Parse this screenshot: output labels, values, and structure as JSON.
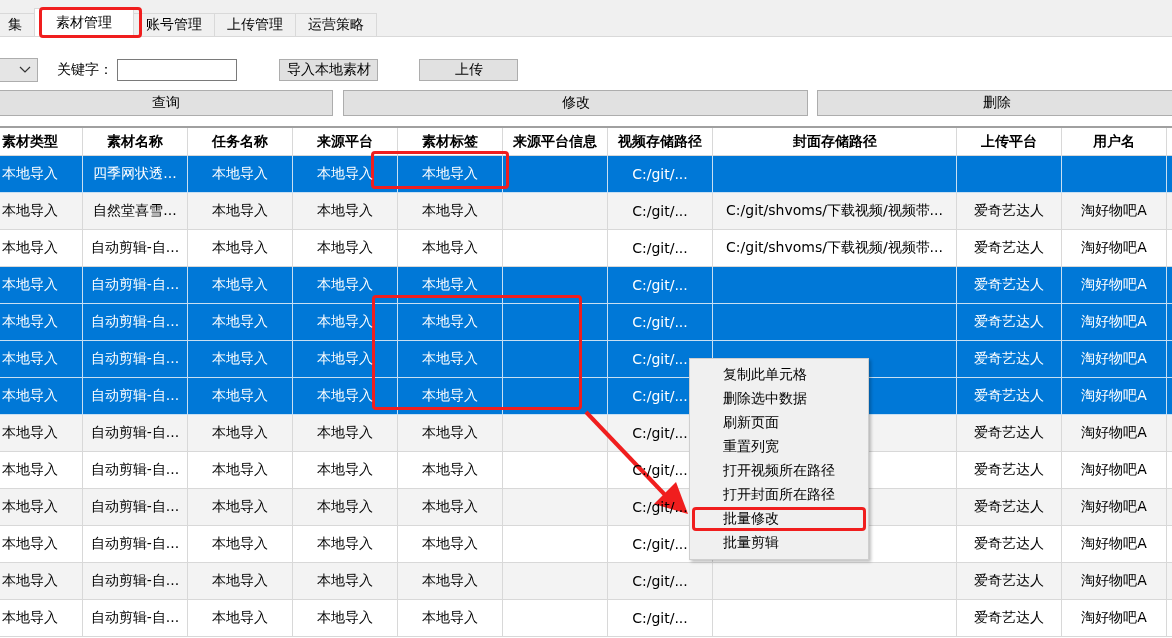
{
  "tabs": [
    {
      "label": "集",
      "selected": false
    },
    {
      "label": "素材管理",
      "selected": true
    },
    {
      "label": "账号管理",
      "selected": false
    },
    {
      "label": "上传管理",
      "selected": false
    },
    {
      "label": "运营策略",
      "selected": false
    }
  ],
  "toolbar": {
    "keyword_label": "关键字：",
    "import_button": "导入本地素材",
    "upload_button": "上传",
    "query_button": "查询",
    "edit_button": "修改",
    "delete_button": "删除"
  },
  "table": {
    "columns": [
      "素材类型",
      "素材名称",
      "任务名称",
      "来源平台",
      "素材标签",
      "来源平台信息",
      "视频存储路径",
      "封面存储路径",
      "上传平台",
      "用户名"
    ],
    "rows": [
      {
        "selected": true,
        "cells": [
          "本地导入",
          "四季网状透...",
          "本地导入",
          "本地导入",
          "本地导入",
          "",
          "C:/git/...",
          "",
          "",
          ""
        ]
      },
      {
        "selected": false,
        "cells": [
          "本地导入",
          "自然堂喜雪...",
          "本地导入",
          "本地导入",
          "本地导入",
          "",
          "C:/git/...",
          "C:/git/shvoms/下载视频/视频带...",
          "爱奇艺达人",
          "淘好物吧A"
        ]
      },
      {
        "selected": false,
        "cells": [
          "本地导入",
          "自动剪辑-自...",
          "本地导入",
          "本地导入",
          "本地导入",
          "",
          "C:/git/...",
          "C:/git/shvoms/下载视频/视频带...",
          "爱奇艺达人",
          "淘好物吧A"
        ]
      },
      {
        "selected": true,
        "cells": [
          "本地导入",
          "自动剪辑-自...",
          "本地导入",
          "本地导入",
          "本地导入",
          "",
          "C:/git/...",
          "",
          "爱奇艺达人",
          "淘好物吧A"
        ]
      },
      {
        "selected": true,
        "cells": [
          "本地导入",
          "自动剪辑-自...",
          "本地导入",
          "本地导入",
          "本地导入",
          "",
          "C:/git/...",
          "",
          "爱奇艺达人",
          "淘好物吧A"
        ]
      },
      {
        "selected": true,
        "cells": [
          "本地导入",
          "自动剪辑-自...",
          "本地导入",
          "本地导入",
          "本地导入",
          "",
          "C:/git/...",
          "",
          "爱奇艺达人",
          "淘好物吧A"
        ]
      },
      {
        "selected": true,
        "cells": [
          "本地导入",
          "自动剪辑-自...",
          "本地导入",
          "本地导入",
          "本地导入",
          "",
          "C:/git/...",
          "",
          "爱奇艺达人",
          "淘好物吧A"
        ]
      },
      {
        "selected": false,
        "cells": [
          "本地导入",
          "自动剪辑-自...",
          "本地导入",
          "本地导入",
          "本地导入",
          "",
          "C:/git/...",
          "",
          "爱奇艺达人",
          "淘好物吧A"
        ]
      },
      {
        "selected": false,
        "cells": [
          "本地导入",
          "自动剪辑-自...",
          "本地导入",
          "本地导入",
          "本地导入",
          "",
          "C:/git/...",
          "",
          "爱奇艺达人",
          "淘好物吧A"
        ]
      },
      {
        "selected": false,
        "cells": [
          "本地导入",
          "自动剪辑-自...",
          "本地导入",
          "本地导入",
          "本地导入",
          "",
          "C:/git/...",
          "",
          "爱奇艺达人",
          "淘好物吧A"
        ]
      },
      {
        "selected": false,
        "cells": [
          "本地导入",
          "自动剪辑-自...",
          "本地导入",
          "本地导入",
          "本地导入",
          "",
          "C:/git/...",
          "",
          "爱奇艺达人",
          "淘好物吧A"
        ]
      },
      {
        "selected": false,
        "cells": [
          "本地导入",
          "自动剪辑-自...",
          "本地导入",
          "本地导入",
          "本地导入",
          "",
          "C:/git/...",
          "",
          "爱奇艺达人",
          "淘好物吧A"
        ]
      },
      {
        "selected": false,
        "cells": [
          "本地导入",
          "自动剪辑-自...",
          "本地导入",
          "本地导入",
          "本地导入",
          "",
          "C:/git/...",
          "",
          "爱奇艺达人",
          "淘好物吧A"
        ]
      }
    ]
  },
  "context_menu": {
    "items": [
      {
        "label": "复制此单元格",
        "annotated": false
      },
      {
        "label": "删除选中数据",
        "annotated": false
      },
      {
        "label": "刷新页面",
        "annotated": false
      },
      {
        "label": "重置列宽",
        "annotated": false
      },
      {
        "label": "打开视频所在路径",
        "annotated": false
      },
      {
        "label": "打开封面所在路径",
        "annotated": false
      },
      {
        "label": "批量修改",
        "annotated": true
      },
      {
        "label": "批量剪辑",
        "annotated": false
      }
    ]
  }
}
